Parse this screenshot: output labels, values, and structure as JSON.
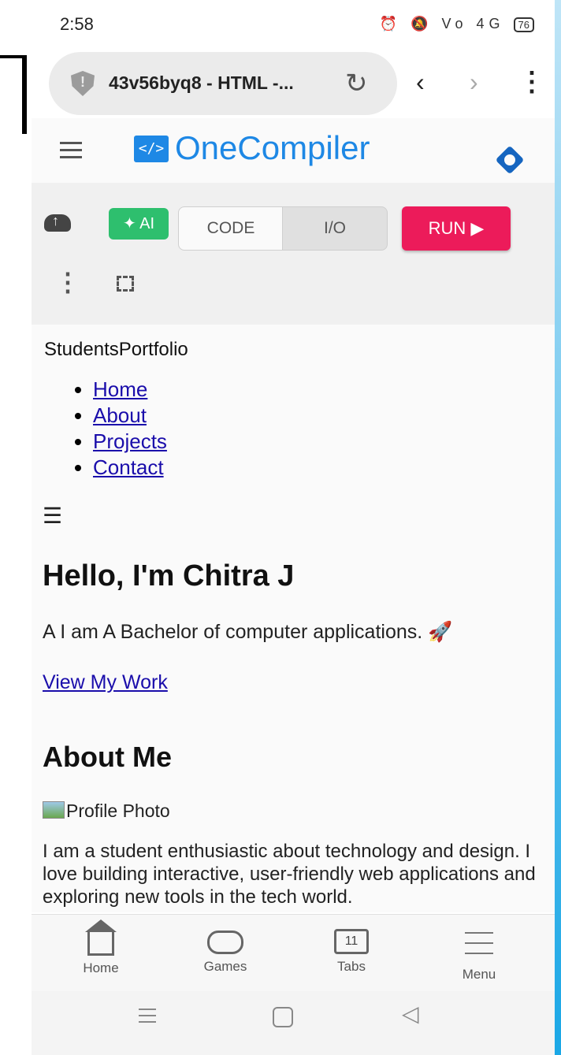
{
  "status_bar": {
    "time": "2:58",
    "icons": "⏰ 🔕 Vo 4G",
    "battery": "76"
  },
  "browser": {
    "url_title": "43v56byq8 - HTML -..."
  },
  "app": {
    "logo_mark": "</>",
    "name": "OneCompiler"
  },
  "toolbar": {
    "ai_label": "✦ AI",
    "code_tab": "CODE",
    "io_tab": "I/O",
    "run_label": "RUN ▶"
  },
  "preview": {
    "brand": "StudentsPortfolio",
    "nav": [
      "Home",
      "About",
      "Projects",
      "Contact"
    ],
    "menu_glyph": "☰",
    "heading": "Hello, I'm Chitra J",
    "tagline": "A I am A Bachelor of computer applications. 🚀",
    "cta": "View My Work",
    "about_heading": "About Me",
    "image_alt": "Profile Photo",
    "about_text": "I am a student enthusiastic about technology and design. I love building interactive, user-friendly web applications and exploring new tools in the tech world."
  },
  "bottom_nav": {
    "home": "Home",
    "games": "Games",
    "tabs": "Tabs",
    "tabs_count": "11",
    "menu": "Menu"
  }
}
